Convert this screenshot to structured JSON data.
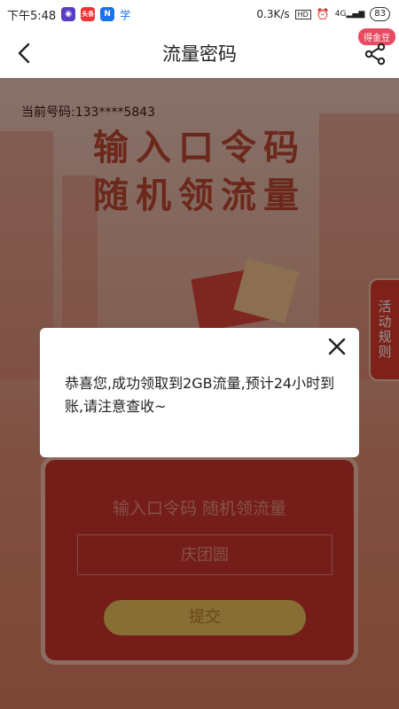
{
  "status_bar": {
    "time": "下午5:48",
    "app_badge_1": "头条",
    "app_badge_2": "N",
    "app_badge_3": "学",
    "network_speed": "0.3K/s",
    "hd_label": "HD",
    "signal_label": "4G",
    "battery": "83"
  },
  "header": {
    "title": "流量密码",
    "gold_badge": "得金豆",
    "back_icon": "back-arrow-icon",
    "share_icon": "share-icon"
  },
  "banner": {
    "phone_number": "当前号码:133****5843",
    "headline_line1": "输入口令码",
    "headline_line2": "随机领流量",
    "rules_tab": "活动规则"
  },
  "form": {
    "label": "输入口令码 随机领流量",
    "input_value": "庆团圆",
    "submit_label": "提交"
  },
  "modal": {
    "message": "恭喜您,成功领取到2GB流量,预计24小时到账,请注意查收~",
    "close_icon": "close-icon"
  },
  "colors": {
    "accent_red": "#c9322b",
    "modal_bg": "#ffffff",
    "submit_gold": "#e8bd5a",
    "gold_badge": "#e84a5f"
  }
}
